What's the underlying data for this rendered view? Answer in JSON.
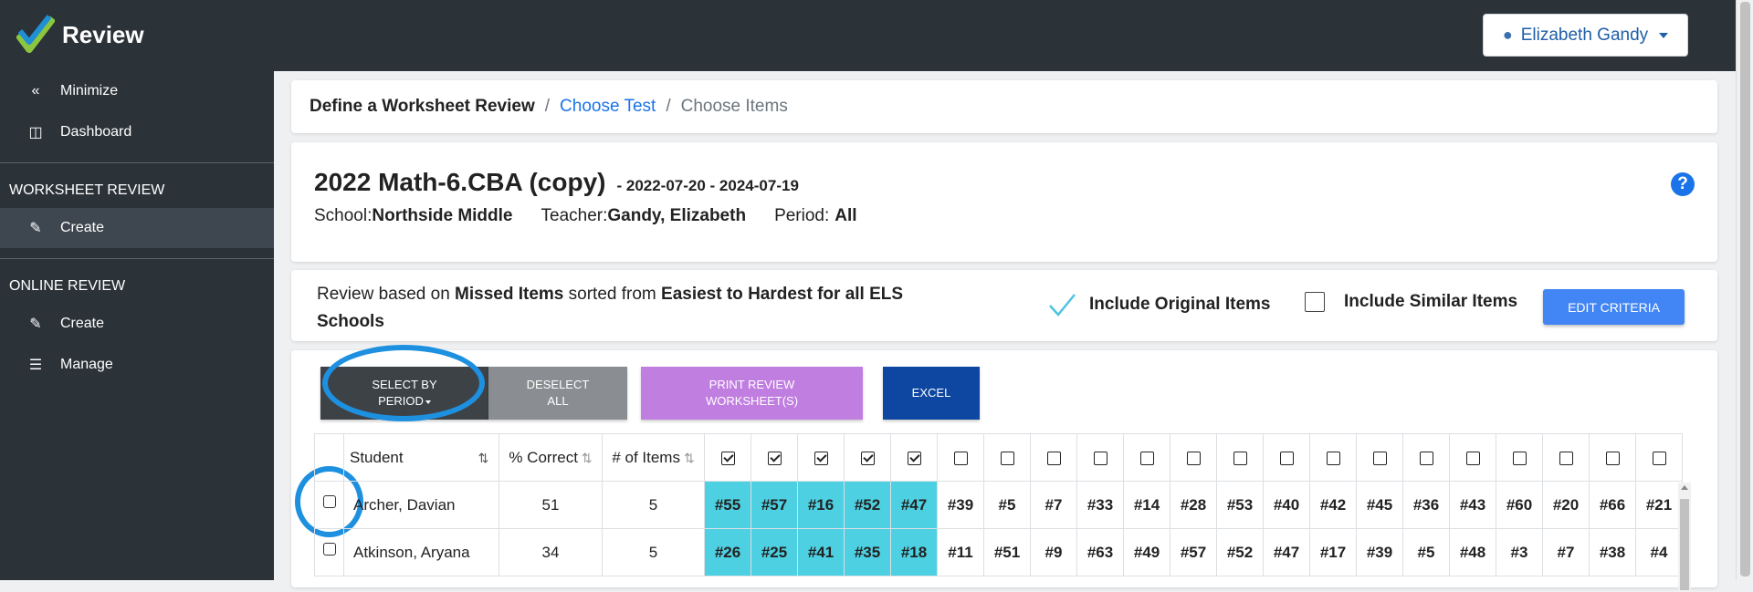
{
  "app": {
    "name": "Review",
    "user": "Elizabeth Gandy"
  },
  "sidebar": {
    "top_items": [
      {
        "label": "Minimize",
        "icon": "double-chevron-left-icon"
      },
      {
        "label": "Dashboard",
        "icon": "dashboard-icon"
      }
    ],
    "sections": [
      {
        "heading": "WORKSHEET REVIEW",
        "items": [
          {
            "label": "Create",
            "icon": "edit-icon",
            "active": true
          }
        ]
      },
      {
        "heading": "ONLINE REVIEW",
        "items": [
          {
            "label": "Create",
            "icon": "edit-icon"
          },
          {
            "label": "Manage",
            "icon": "list-icon"
          }
        ]
      }
    ]
  },
  "breadcrumb": {
    "step1": "Define a Worksheet Review",
    "sep": "/",
    "step2": "Choose Test",
    "step3": "Choose Items"
  },
  "test": {
    "title": "2022 Math-6.CBA (copy)",
    "dates": "- 2022-07-20 - 2024-07-19",
    "school_label": "School:",
    "school": "Northside Middle",
    "teacher_label": "Teacher:",
    "teacher": "Gandy, Elizabeth",
    "period_label": "Period:",
    "period": "All"
  },
  "criteria": {
    "prefix": "Review based on ",
    "basis": "Missed Items",
    "mid": " sorted from ",
    "order": "Easiest to Hardest for all ELS Schools",
    "include_original": "Include Original Items",
    "include_original_checked": true,
    "include_similar": "Include Similar Items",
    "include_similar_checked": false,
    "edit_button": "EDIT CRITERIA"
  },
  "actions": {
    "select_by_period_1": "SELECT BY",
    "select_by_period_2": "PERIOD",
    "deselect_1": "DESELECT",
    "deselect_2": "ALL",
    "print_1": "PRINT REVIEW",
    "print_2": "WORKSHEET(S)",
    "excel": "EXCEL"
  },
  "colors": {
    "sidebar": "#2b3238",
    "accent": "#4285f4",
    "highlight": "#4dd0e1",
    "print": "#c07ee0",
    "excel": "#0d47a1",
    "select": "#3d4247",
    "deselect": "#8a8d91",
    "ring": "#1e90e0"
  },
  "table": {
    "headers": {
      "student": "Student",
      "pct": "% Correct",
      "items": "# of Items"
    },
    "item_checks": [
      true,
      true,
      true,
      true,
      true,
      false,
      false,
      false,
      false,
      false,
      false,
      false,
      false,
      false,
      false,
      false,
      false,
      false,
      false,
      false,
      false
    ],
    "rows": [
      {
        "name": "Archer, Davian",
        "pct": "51",
        "count": "5",
        "items": [
          "#55",
          "#57",
          "#16",
          "#52",
          "#47",
          "#39",
          "#5",
          "#7",
          "#33",
          "#14",
          "#28",
          "#53",
          "#40",
          "#42",
          "#45",
          "#36",
          "#43",
          "#60",
          "#20",
          "#66",
          "#21"
        ]
      },
      {
        "name": "Atkinson, Aryana",
        "pct": "34",
        "count": "5",
        "items": [
          "#26",
          "#25",
          "#41",
          "#35",
          "#18",
          "#11",
          "#51",
          "#9",
          "#63",
          "#49",
          "#57",
          "#52",
          "#47",
          "#17",
          "#39",
          "#5",
          "#48",
          "#3",
          "#7",
          "#38",
          "#4"
        ]
      }
    ],
    "highlight_count": 5
  }
}
